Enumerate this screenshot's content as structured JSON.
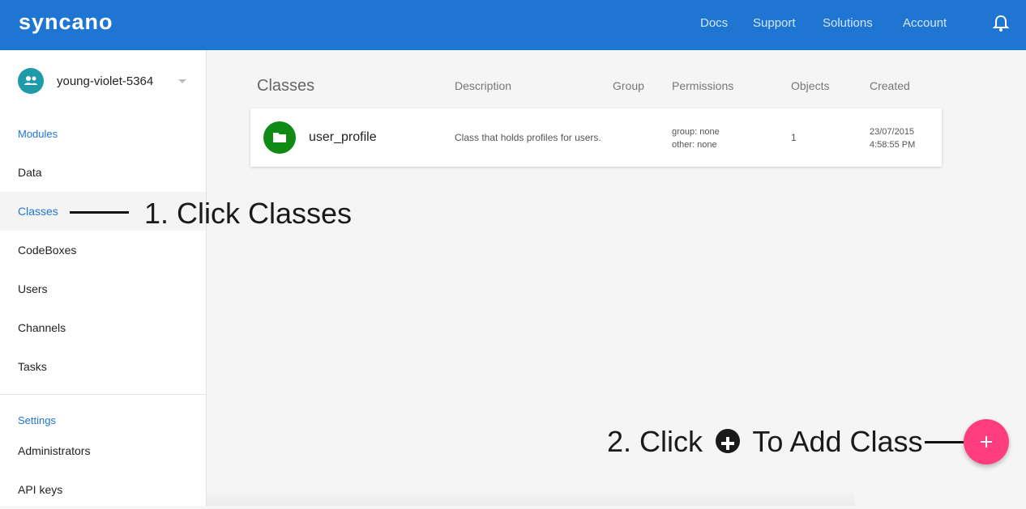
{
  "header": {
    "logo": "syncano",
    "nav": [
      "Docs",
      "Support",
      "Solutions",
      "Account"
    ],
    "bell_icon": "bell-icon",
    "bg_color": "#1e76d2"
  },
  "sidebar": {
    "instance_name": "young-violet-5364",
    "instance_icon": "people-icon",
    "modules_label": "Modules",
    "modules": [
      "Data",
      "Classes",
      "CodeBoxes",
      "Users",
      "Channels",
      "Tasks"
    ],
    "active_item": "Classes",
    "settings_label": "Settings",
    "settings": [
      "Administrators",
      "API keys"
    ]
  },
  "table": {
    "headers": {
      "classes": "Classes",
      "description": "Description",
      "group": "Group",
      "permissions": "Permissions",
      "objects": "Objects",
      "created": "Created"
    },
    "rows": [
      {
        "icon": "folder-icon",
        "name": "user_profile",
        "description": "Class that holds profiles for users.",
        "permissions": [
          "group: none",
          "other: none"
        ],
        "objects": "1",
        "created": [
          "23/07/2015",
          "4:58:55 PM"
        ]
      }
    ]
  },
  "annotations": {
    "step1": "1. Click Classes",
    "step2_pre": "2. Click",
    "step2_post": "To Add Class"
  },
  "fab": {
    "icon": "plus-icon",
    "color": "#ff3d7f"
  }
}
